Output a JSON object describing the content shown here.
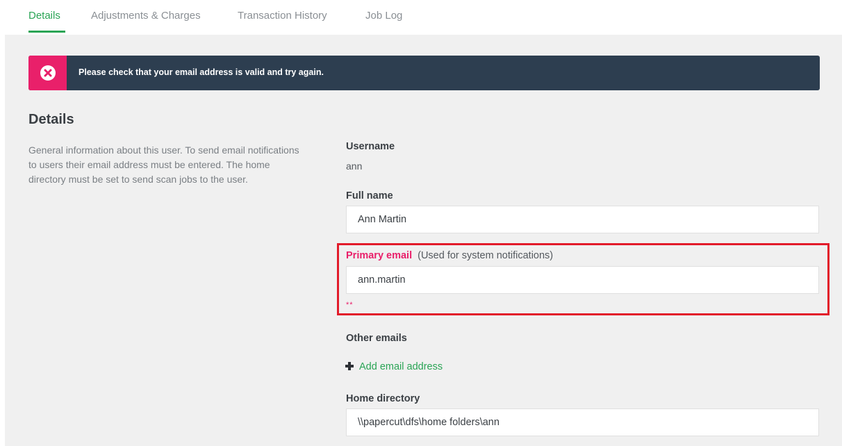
{
  "tabs": [
    {
      "label": "Details",
      "active": true
    },
    {
      "label": "Adjustments & Charges",
      "active": false
    },
    {
      "label": "Transaction History",
      "active": false
    },
    {
      "label": "Job Log",
      "active": false
    }
  ],
  "alert": {
    "message": "Please check that your email address is valid and try again.",
    "icon": "error-x-icon",
    "color": "#e9206a",
    "background": "#2d3e50"
  },
  "details": {
    "title": "Details",
    "description": "General information about this user. To send email notifications to users their email address must be entered. The home directory must be set to send scan jobs to the user."
  },
  "fields": {
    "username_label": "Username",
    "username_value": "ann",
    "fullname_label": "Full name",
    "fullname_value": "Ann Martin",
    "primary_email_label": "Primary email",
    "primary_email_note": "(Used for system notifications)",
    "primary_email_value": "ann.martin",
    "primary_email_error": "**",
    "other_emails_label": "Other emails",
    "add_email_label": "Add email address",
    "home_dir_label": "Home directory",
    "home_dir_value": "\\\\papercut\\dfs\\home folders\\ann"
  },
  "colors": {
    "accent": "#2aa455",
    "error": "#e9206a",
    "highlight_border": "#e21b2a"
  }
}
